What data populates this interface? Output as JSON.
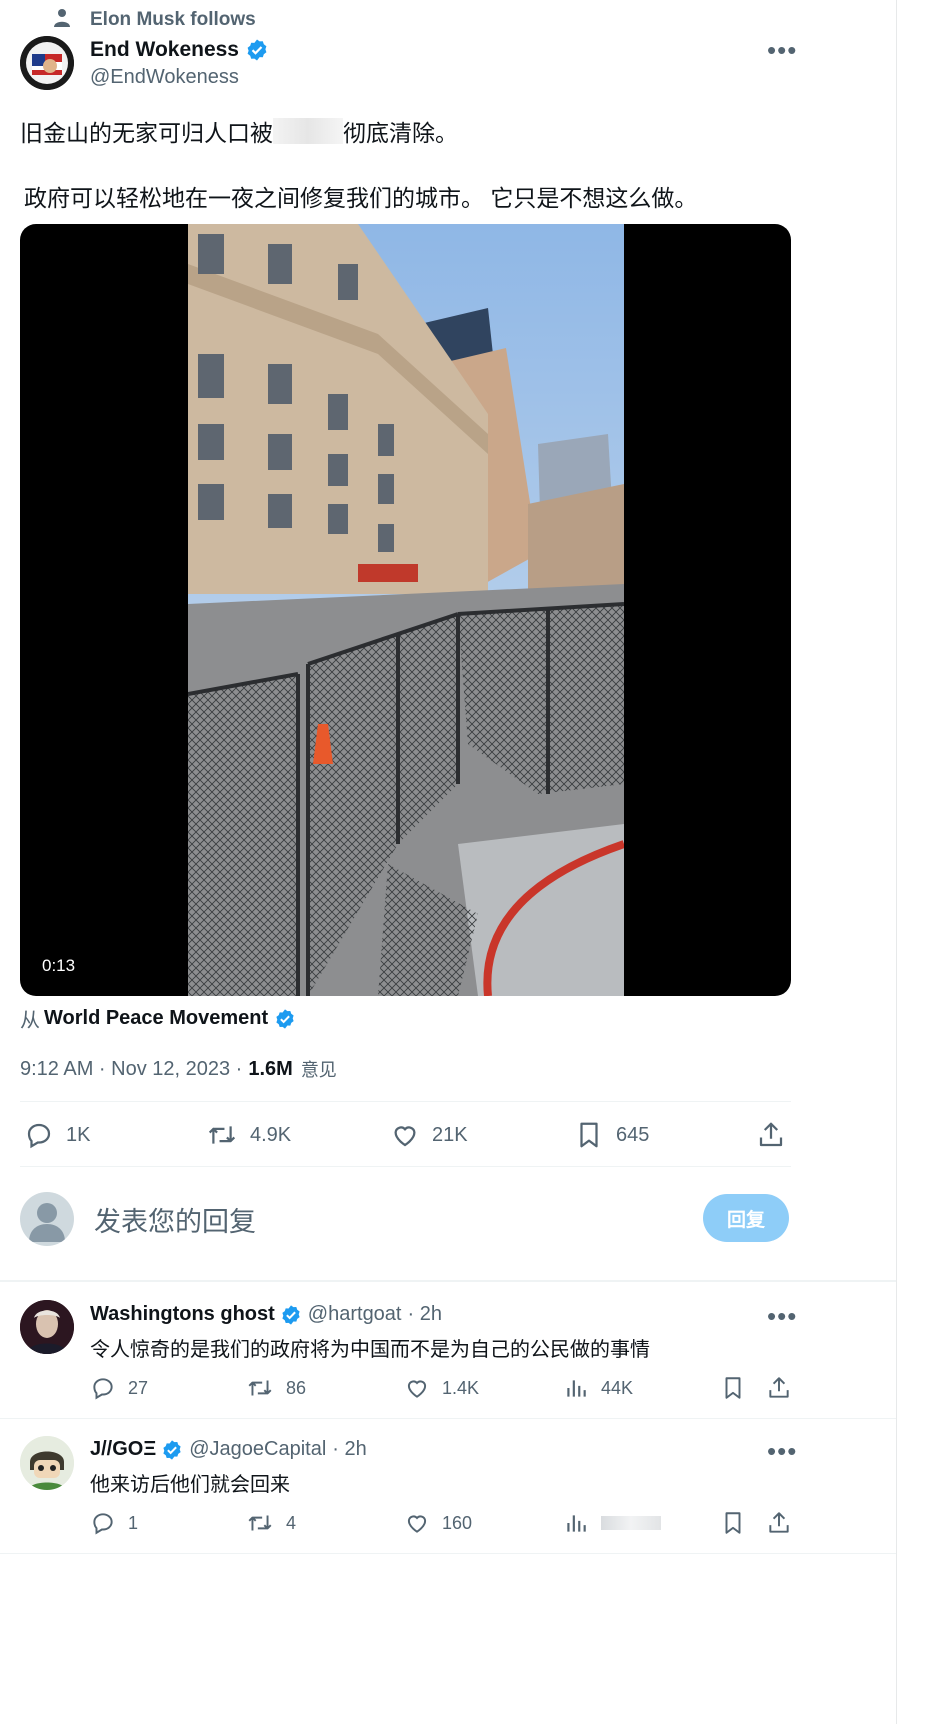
{
  "social_context": "Elon Musk follows",
  "tweet": {
    "display_name": "End Wokeness",
    "handle": "@EndWokeness",
    "text_line1_before": "旧金山的无家可归人口被",
    "text_line1_after": "彻底清除。",
    "text_line2": "政府可以轻松地在一夜之间修复我们的城市。 它只是不想这么做。",
    "video_duration": "0:13",
    "attribution_prefix": "从",
    "attribution_name": "World Peace Movement",
    "timestamp": "9:12 AM · Nov 12, 2023 · ",
    "views_count": "1.6M",
    "views_label": "意见",
    "stats": {
      "replies": "1K",
      "retweets": "4.9K",
      "likes": "21K",
      "bookmarks": "645"
    }
  },
  "compose": {
    "placeholder": "发表您的回复",
    "reply_button": "回复"
  },
  "replies": [
    {
      "display_name": "Washingtons ghost",
      "handle": "@hartgoat",
      "dot_time": "· 2h",
      "text": "令人惊奇的是我们的政府将为中国而不是为自己的公民做的事情",
      "replies": "27",
      "retweets": "86",
      "likes": "1.4K",
      "views": "44K"
    },
    {
      "display_name": "J//GOΞ",
      "handle": "@JagoeCapital",
      "dot_time": "· 2h",
      "text": "他来访后他们就会回来",
      "replies": "1",
      "retweets": "4",
      "likes": "160",
      "views": ""
    }
  ],
  "colors": {
    "accent": "#1d9bf0",
    "text": "#0f1419",
    "muted": "#536471",
    "reply_button_disabled": "#8ecdf8"
  }
}
